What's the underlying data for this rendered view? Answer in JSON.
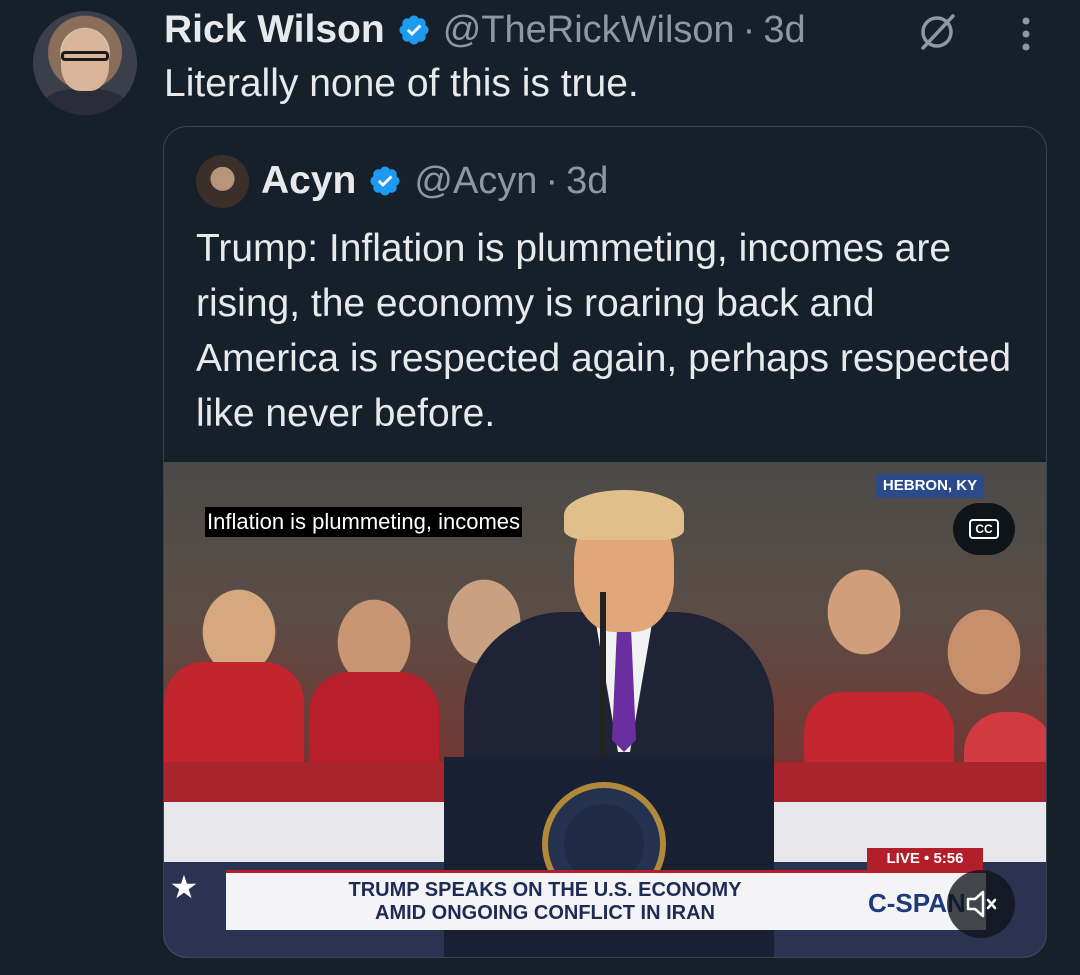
{
  "tweet": {
    "author": {
      "display_name": "Rick Wilson",
      "handle": "@TheRickWilson",
      "verified": true
    },
    "separator": "·",
    "time": "3d",
    "text": "Literally none of this is true.",
    "icons": {
      "grok": "grok-icon",
      "more": "more-vertical-icon"
    }
  },
  "quote": {
    "author": {
      "display_name": "Acyn",
      "handle": "@Acyn",
      "verified": true
    },
    "separator": "·",
    "time": "3d",
    "text": "Trump: Inflation is plummeting, incomes are rising, the economy is roaring back and America is respected again, perhaps respected like never before.",
    "video": {
      "caption": "Inflation is plummeting, incomes",
      "location": "HEBRON, KY",
      "cc_label": "CC",
      "lower_third_line1": "TRUMP SPEAKS ON THE U.S. ECONOMY",
      "lower_third_line2": "AMID ONGOING CONFLICT IN IRAN",
      "live_label": "LIVE • 5:56",
      "network": "C-SPAN",
      "muted": true
    }
  },
  "colors": {
    "background": "#15202b",
    "text_primary": "#e7e9ea",
    "text_secondary": "#8b98a5",
    "verified": "#1d9bf0",
    "border": "#38444d"
  }
}
